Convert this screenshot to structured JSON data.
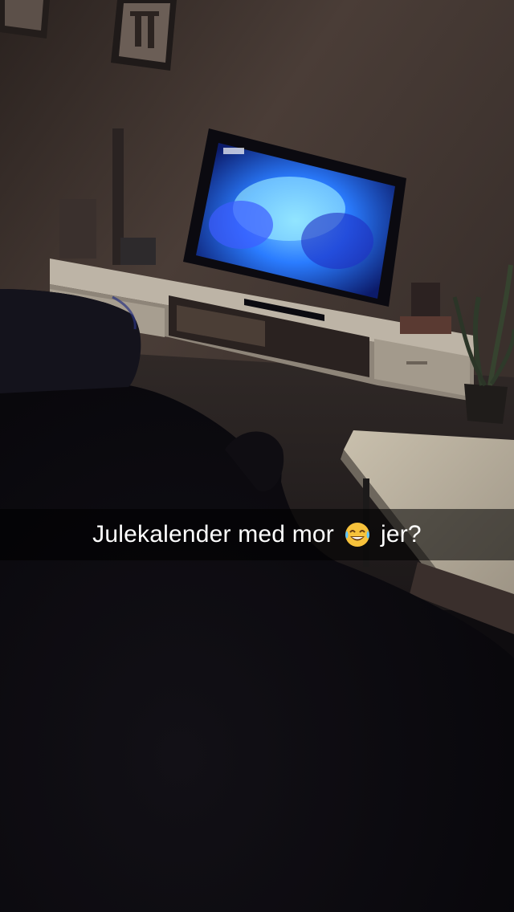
{
  "snap": {
    "caption": {
      "text_before": "Julekalender med mor",
      "emoji_icon": "face-with-tears-of-joy-icon",
      "text_after": "jer?"
    },
    "colors": {
      "wall": "#3b2f2a",
      "tv_glow": "#2f7cff",
      "caption_bg": "rgba(0,0,0,0.55)",
      "caption_text": "#ffffff"
    }
  }
}
